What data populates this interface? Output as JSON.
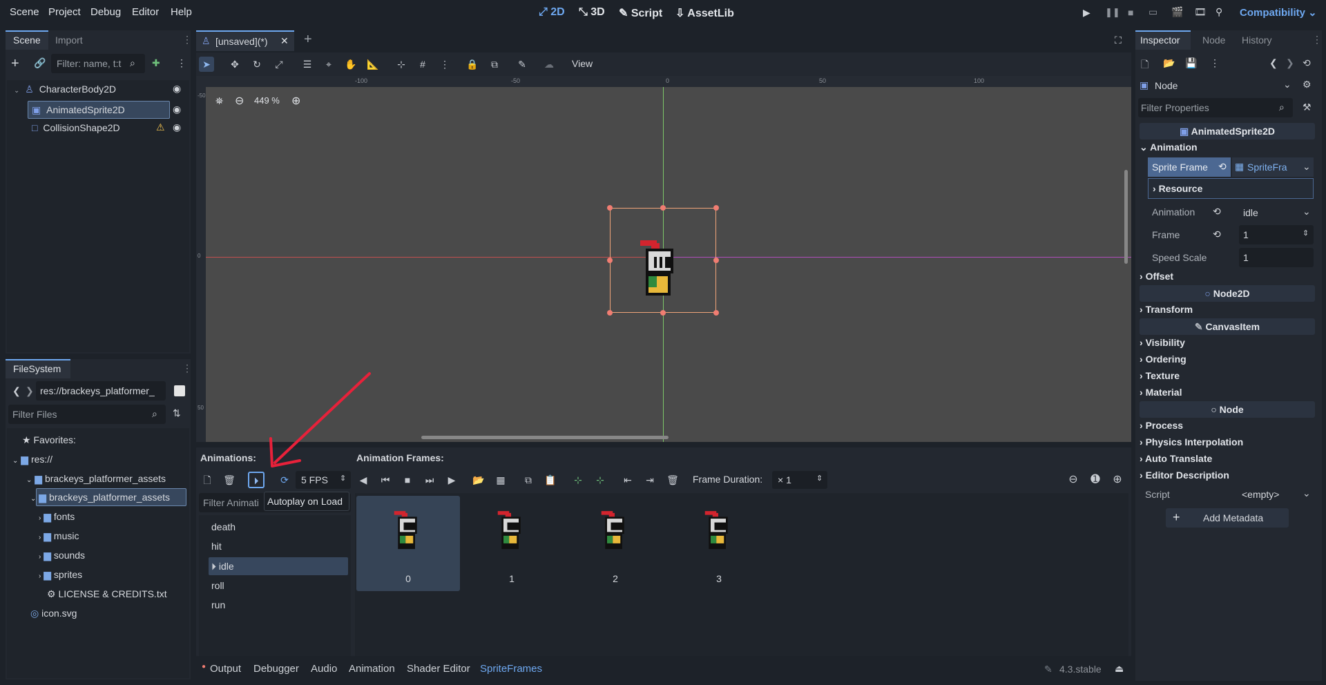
{
  "menu": [
    "Scene",
    "Project",
    "Debug",
    "Editor",
    "Help"
  ],
  "workspaces": [
    {
      "label": "2D",
      "active": true
    },
    {
      "label": "3D",
      "active": false
    },
    {
      "label": "Script",
      "active": false
    },
    {
      "label": "AssetLib",
      "active": false
    }
  ],
  "renderer": "Compatibility",
  "scene_dock": {
    "tabs": [
      "Scene",
      "Import"
    ],
    "filter_placeholder": "Filter: name, t:t",
    "nodes": [
      {
        "name": "CharacterBody2D"
      },
      {
        "name": "AnimatedSprite2D"
      },
      {
        "name": "CollisionShape2D"
      }
    ]
  },
  "filesystem": {
    "tab": "FileSystem",
    "path": "res://brackeys_platformer_",
    "filter_placeholder": "Filter Files",
    "items": [
      "Favorites:",
      "res://",
      "brackeys_platformer_assets",
      "brackeys_platformer_assets",
      "fonts",
      "music",
      "sounds",
      "sprites",
      "LICENSE & CREDITS.txt",
      "icon.svg"
    ]
  },
  "editor_tab": {
    "title": "[unsaved](*)"
  },
  "toolbar": {
    "view_label": "View"
  },
  "viewport": {
    "zoom": "449 %",
    "ruler_marks": [
      "-100",
      "-50",
      "0",
      "50",
      "100"
    ],
    "vruler_marks": [
      "-50",
      "0",
      "50"
    ]
  },
  "annotation": {
    "color": "#e8213a"
  },
  "spriteframes": {
    "animations_label": "Animations:",
    "frames_label": "Animation Frames:",
    "fps": "5 FPS",
    "filter_placeholder": "Filter Animati",
    "tooltip": "Autoplay on Load",
    "frame_duration_label": "Frame Duration:",
    "frame_duration_value": "× 1",
    "animations": [
      "death",
      "hit",
      "idle",
      "roll",
      "run"
    ],
    "selected_animation": "idle",
    "frames": [
      "0",
      "1",
      "2",
      "3"
    ]
  },
  "bottom_tabs": [
    "Output",
    "Debugger",
    "Audio",
    "Animation",
    "Shader Editor",
    "SpriteFrames"
  ],
  "version": "4.3.stable",
  "inspector": {
    "tabs": [
      "Inspector",
      "Node",
      "History"
    ],
    "node": "Node",
    "filter_placeholder": "Filter Properties",
    "class_header": "AnimatedSprite2D",
    "section_animation": "Animation",
    "sprite_frames_label": "Sprite Frame",
    "sprite_frames_value": "SpriteFra",
    "resource_label": "Resource",
    "animation_label": "Animation",
    "animation_value": "idle",
    "frame_label": "Frame",
    "frame_value": "1",
    "speed_label": "Speed Scale",
    "speed_value": "1",
    "offset": "Offset",
    "node2d": "Node2D",
    "transform": "Transform",
    "canvasitem": "CanvasItem",
    "visibility": "Visibility",
    "ordering": "Ordering",
    "texture": "Texture",
    "material": "Material",
    "process": "Process",
    "physics": "Physics Interpolation",
    "autotranslate": "Auto Translate",
    "editordesc": "Editor Description",
    "script_label": "Script",
    "script_value": "<empty>",
    "add_metadata": "Add Metadata"
  }
}
